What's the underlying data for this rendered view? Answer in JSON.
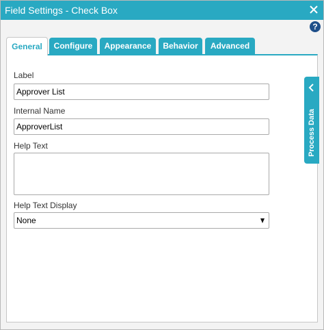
{
  "window": {
    "title": "Field Settings - Check Box",
    "close_icon": "close-icon",
    "help_glyph": "?"
  },
  "colors": {
    "accent": "#29a9c2",
    "panel_background": "#f3f3f3",
    "help_icon": "#1f4f8a"
  },
  "tabs": [
    {
      "label": "General",
      "active": true
    },
    {
      "label": "Configure",
      "active": false
    },
    {
      "label": "Appearance",
      "active": false
    },
    {
      "label": "Behavior",
      "active": false
    },
    {
      "label": "Advanced",
      "active": false
    }
  ],
  "form": {
    "label": {
      "label": "Label",
      "value": "Approver List"
    },
    "internal_name": {
      "label": "Internal Name",
      "value": "ApproverList"
    },
    "help_text": {
      "label": "Help Text",
      "value": ""
    },
    "help_text_display": {
      "label": "Help Text Display",
      "value": "None"
    }
  },
  "side_panel": {
    "label": "Process Data",
    "icon": "chevron-left-icon"
  }
}
